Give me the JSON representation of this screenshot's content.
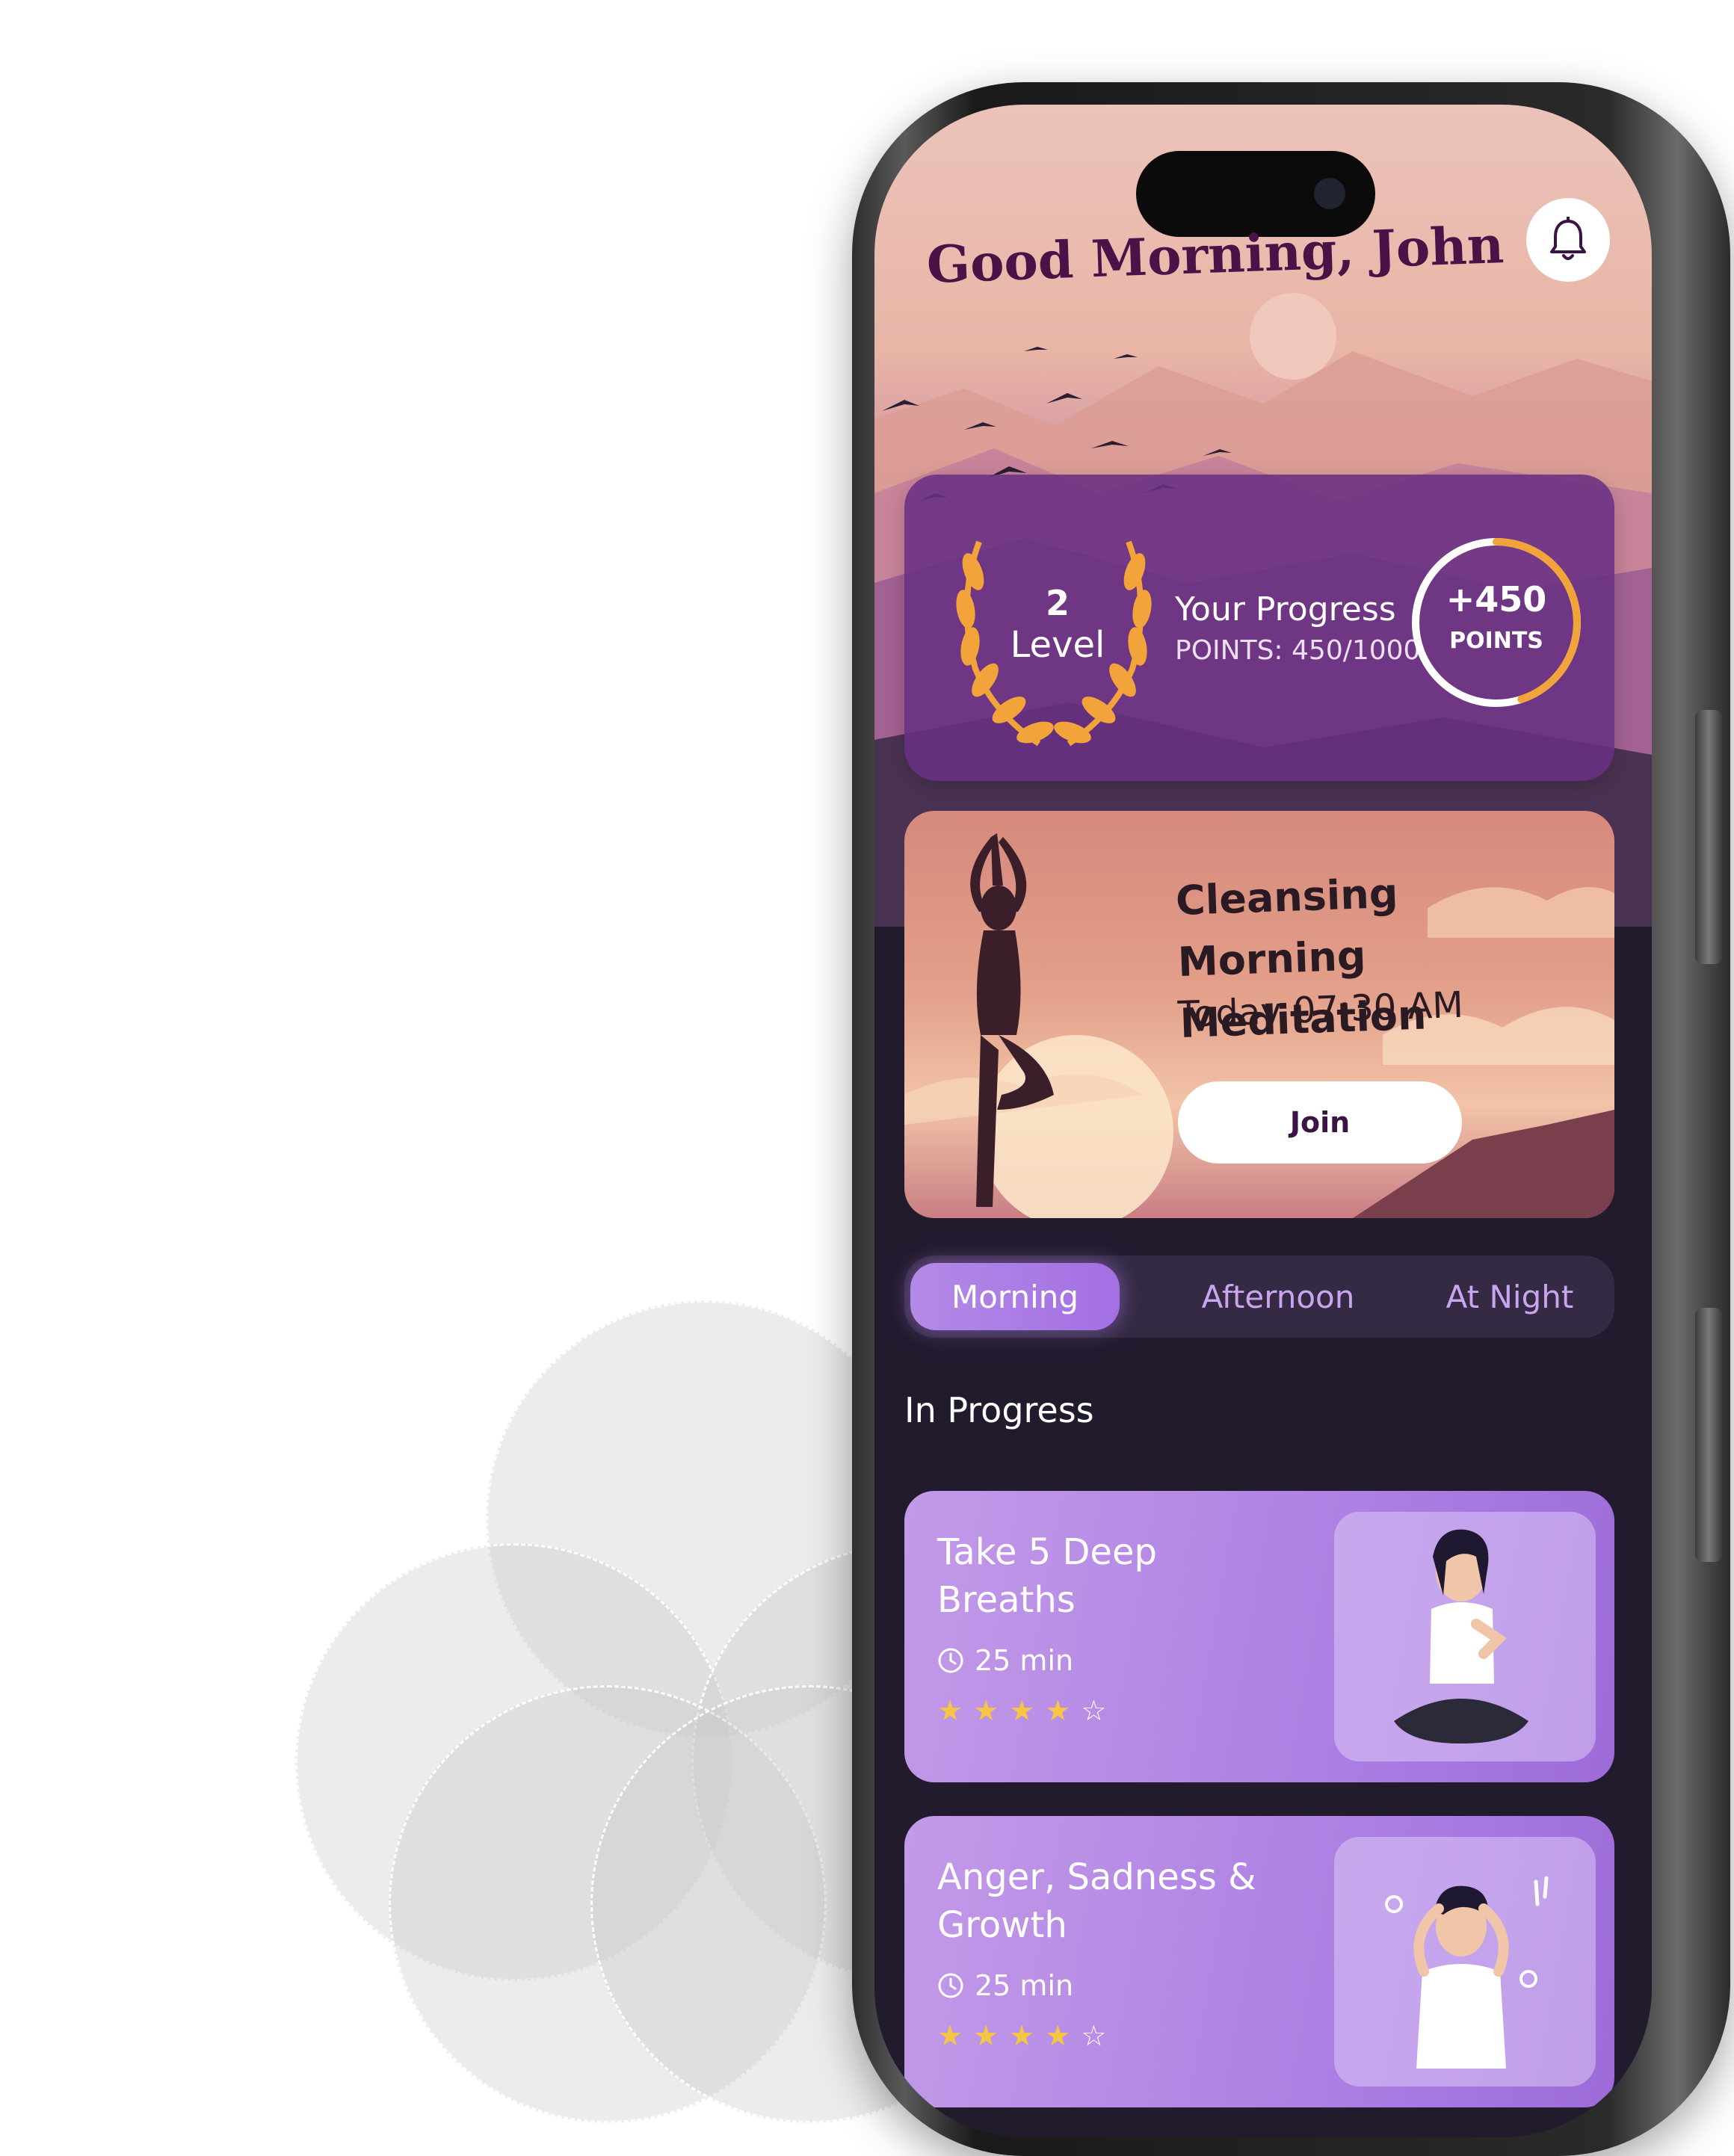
{
  "greeting": "Good Morning, John",
  "icons": {
    "notification": "bell-icon",
    "laurel": "laurel-wreath-icon",
    "clock": "clock-icon",
    "star": "star-icon"
  },
  "progress": {
    "level_number": "2",
    "level_label": "Level",
    "title": "Your Progress",
    "points_text": "POINTS: 450/1000",
    "points_value": 450,
    "points_max": 1000,
    "ring_value": "+450",
    "ring_unit": "POINTS"
  },
  "meditation": {
    "title": "Cleansing Morning Meditation",
    "time": "Today 07:30 AM",
    "join_label": "Join"
  },
  "tabs": [
    {
      "label": "Morning",
      "active": true
    },
    {
      "label": "Afternoon",
      "active": false
    },
    {
      "label": "At Night",
      "active": false
    }
  ],
  "section_title": "In Progress",
  "courses": [
    {
      "title": "Take 5 Deep Breaths",
      "duration": "25 min",
      "rating": 4,
      "rating_max": 5
    },
    {
      "title": "Anger, Sadness & Growth",
      "duration": "25 min",
      "rating": 4,
      "rating_max": 5
    }
  ],
  "colors": {
    "greeting": "#4a1247",
    "progress_card": "#683082",
    "ring_accent": "#f2a33a",
    "tab_active": "#a36fe3",
    "course_card": "#b58be6",
    "star": "#f6c543",
    "app_background": "#221b2e"
  }
}
